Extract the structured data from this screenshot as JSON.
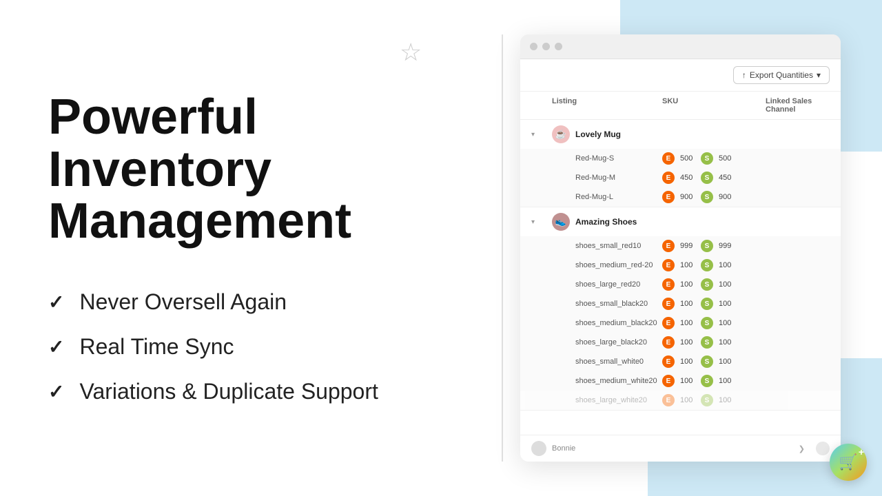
{
  "background": {
    "top_right_color": "#cde8f5",
    "bottom_right_color": "#cde8f5"
  },
  "left": {
    "title_line1": "Powerful Inventory",
    "title_line2": "Management",
    "features": [
      {
        "id": "f1",
        "text": "Never Oversell Again"
      },
      {
        "id": "f2",
        "text": "Real Time Sync"
      },
      {
        "id": "f3",
        "text": "Variations & Duplicate Support"
      }
    ]
  },
  "browser": {
    "dots": [
      "dot1",
      "dot2",
      "dot3"
    ],
    "toolbar": {
      "export_label": "Export Quantities",
      "export_arrow": "▾",
      "export_icon": "↑"
    },
    "table": {
      "headers": [
        "",
        "Listing",
        "SKU",
        "Linked Sales Channel"
      ],
      "products": [
        {
          "id": "p1",
          "name": "Lovely Mug",
          "thumb_emoji": "☕",
          "thumb_bg": "#e8c0c0",
          "skus": [
            {
              "sku": "Red-Mug-S",
              "etsy_qty": "500",
              "shopify_qty": "500"
            },
            {
              "sku": "Red-Mug-M",
              "etsy_qty": "450",
              "shopify_qty": "450"
            },
            {
              "sku": "Red-Mug-L",
              "etsy_qty": "900",
              "shopify_qty": "900"
            }
          ]
        },
        {
          "id": "p2",
          "name": "Amazing Shoes",
          "thumb_emoji": "👟",
          "thumb_bg": "#c0a0a0",
          "skus": [
            {
              "sku": "shoes_small_red10",
              "etsy_qty": "999",
              "shopify_qty": "999",
              "shopify_faded": false
            },
            {
              "sku": "shoes_medium_red-20",
              "etsy_qty": "100",
              "shopify_qty": "100",
              "shopify_faded": false
            },
            {
              "sku": "shoes_large_red20",
              "etsy_qty": "100",
              "shopify_qty": "100",
              "shopify_faded": false
            },
            {
              "sku": "shoes_small_black20",
              "etsy_qty": "100",
              "shopify_qty": "100",
              "shopify_faded": false
            },
            {
              "sku": "shoes_medium_black20",
              "etsy_qty": "100",
              "shopify_qty": "100",
              "shopify_faded": false
            },
            {
              "sku": "shoes_large_black20",
              "etsy_qty": "100",
              "shopify_qty": "100",
              "shopify_faded": false
            },
            {
              "sku": "shoes_small_white0",
              "etsy_qty": "100",
              "shopify_qty": "100",
              "shopify_faded": false
            },
            {
              "sku": "shoes_medium_white20",
              "etsy_qty": "100",
              "shopify_qty": "100",
              "shopify_faded": false
            },
            {
              "sku": "shoes_large_white20",
              "etsy_qty": "100",
              "shopify_qty": "100",
              "shopify_faded": true
            }
          ]
        }
      ],
      "footer": {
        "name": "Bonnie",
        "arrow": "❯",
        "page_icon": "+"
      }
    }
  },
  "fab": {
    "icon": "🛒",
    "plus": "+"
  }
}
